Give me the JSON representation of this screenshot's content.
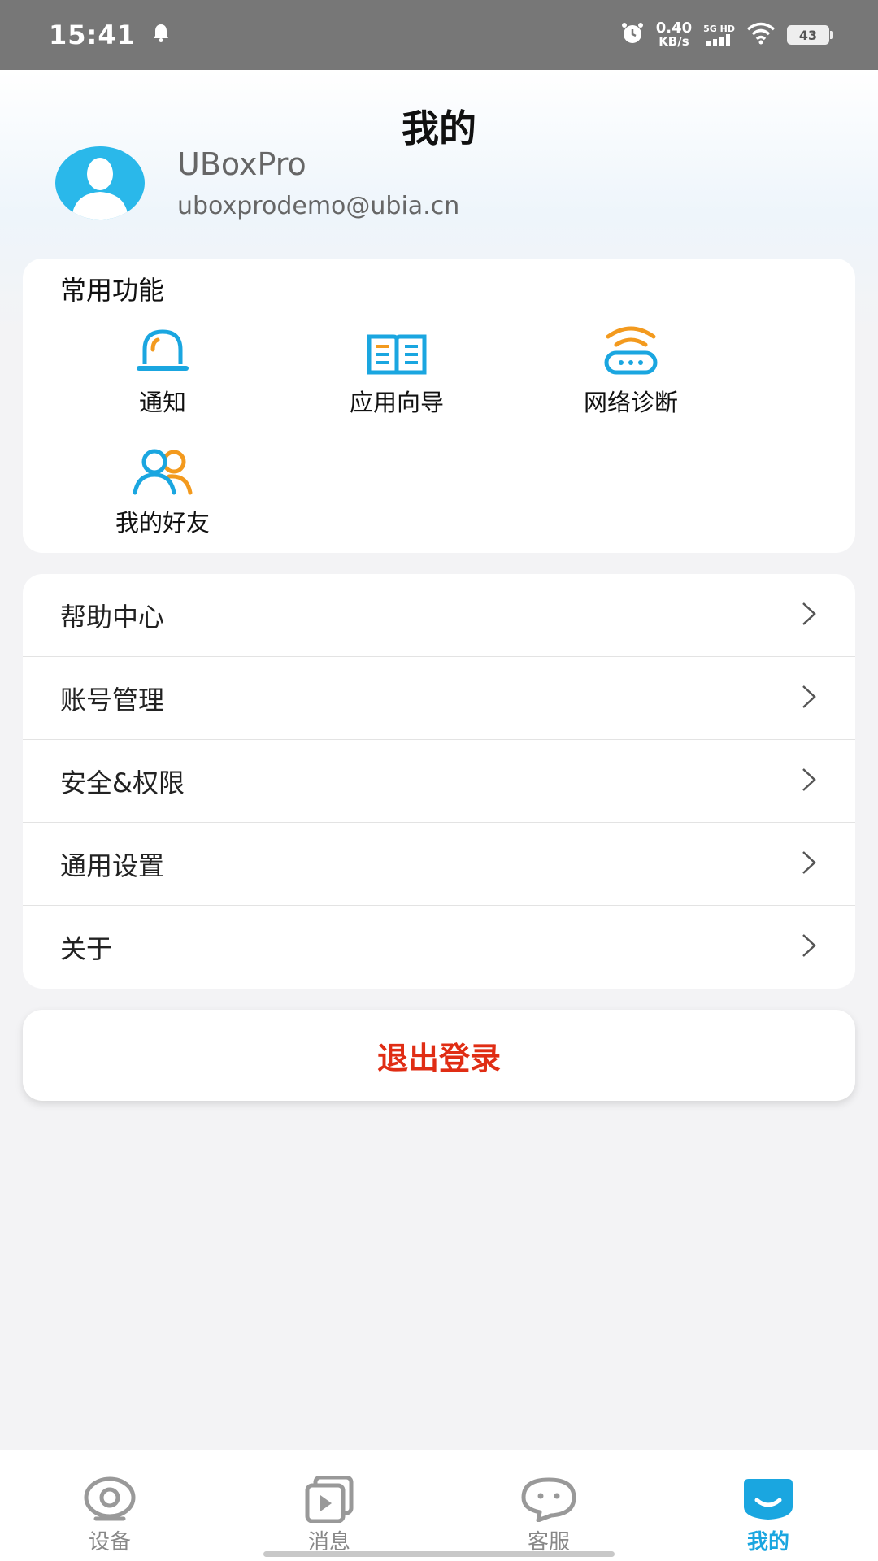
{
  "status_bar": {
    "time": "15:41",
    "net_speed_value": "0.40",
    "net_speed_unit": "KB/s",
    "signal_label": "5G HD",
    "battery": "43"
  },
  "header": {
    "title": "我的",
    "username": "UBoxPro",
    "email": "uboxprodemo@ubia.cn"
  },
  "quick": {
    "section_title": "常用功能",
    "items": [
      {
        "label": "通知",
        "icon": "notification-bell-icon"
      },
      {
        "label": "应用向导",
        "icon": "guide-book-icon"
      },
      {
        "label": "网络诊断",
        "icon": "network-router-icon"
      },
      {
        "label": "我的好友",
        "icon": "friends-icon"
      }
    ]
  },
  "menu": {
    "items": [
      {
        "label": "帮助中心"
      },
      {
        "label": "账号管理"
      },
      {
        "label": "安全&权限"
      },
      {
        "label": "通用设置"
      },
      {
        "label": "关于"
      }
    ]
  },
  "logout_label": "退出登录",
  "tabs": [
    {
      "label": "设备",
      "icon": "device-camera-icon"
    },
    {
      "label": "消息",
      "icon": "message-video-icon"
    },
    {
      "label": "客服",
      "icon": "chat-bubble-icon"
    },
    {
      "label": "我的",
      "icon": "profile-smile-icon",
      "active": true
    }
  ],
  "colors": {
    "accent": "#1aa6e0",
    "avatar": "#2ab8ea",
    "orange": "#f39a1e",
    "logout": "#e02d14"
  }
}
